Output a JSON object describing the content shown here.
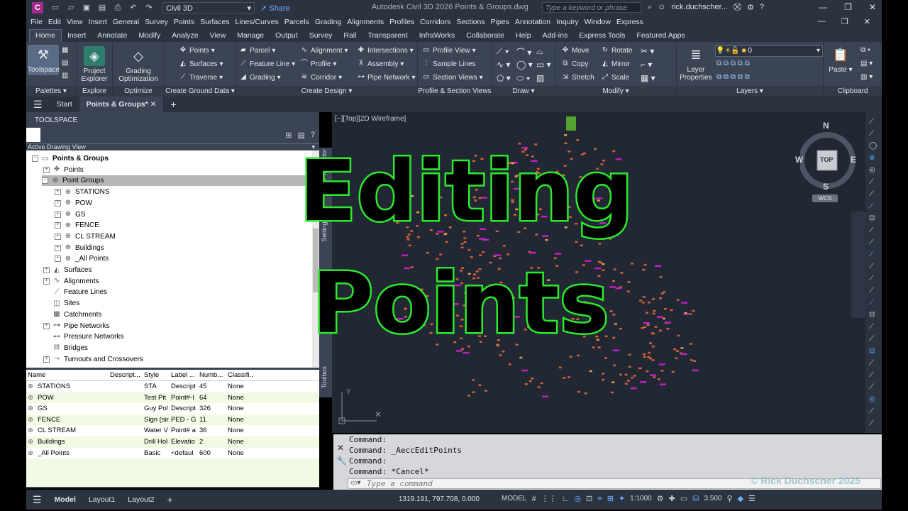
{
  "titlebar": {
    "app_icon": "C",
    "workspace": "Civil 3D",
    "share": "Share",
    "title": "Autodesk Civil 3D 2026   Points & Groups.dwg",
    "search_placeholder": "Type a keyword or phrase",
    "user": "rick.duchscher..."
  },
  "menubar": [
    "File",
    "Edit",
    "View",
    "Insert",
    "General",
    "Survey",
    "Points",
    "Surfaces",
    "Lines/Curves",
    "Parcels",
    "Grading",
    "Alignments",
    "Profiles",
    "Corridors",
    "Sections",
    "Pipes",
    "Annotation",
    "Inquiry",
    "Window",
    "Express"
  ],
  "ribbon_tabs": [
    "Home",
    "Insert",
    "Annotate",
    "Modify",
    "Analyze",
    "View",
    "Manage",
    "Output",
    "Survey",
    "Rail",
    "Transparent",
    "InfraWorks",
    "Collaborate",
    "Help",
    "Add-ins",
    "Express Tools",
    "Featured Apps"
  ],
  "ribbon": {
    "palettes": {
      "title": "Palettes",
      "toolspace": "Toolspace"
    },
    "explore": {
      "title": "Explore",
      "project_explorer": "Project Explorer"
    },
    "optimize": {
      "title": "Optimize",
      "grading_optimization": "Grading Optimization"
    },
    "ground": {
      "title": "Create Ground Data",
      "points": "Points",
      "surfaces": "Surfaces",
      "traverse": "Traverse"
    },
    "design": {
      "title": "Create Design",
      "parcel": "Parcel",
      "feature_line": "Feature Line",
      "grading": "Grading",
      "alignment": "Alignment",
      "profile": "Profile",
      "corridor": "Corridor",
      "intersections": "Intersections",
      "assembly": "Assembly",
      "pipe_network": "Pipe Network"
    },
    "profile_section": {
      "title": "Profile & Section Views",
      "profile_view": "Profile View",
      "sample_lines": "Sample Lines",
      "section_views": "Section Views"
    },
    "draw": {
      "title": "Draw"
    },
    "modify": {
      "title": "Modify",
      "move": "Move",
      "rotate": "Rotate",
      "copy": "Copy",
      "mirror": "Mirror",
      "stretch": "Stretch",
      "scale": "Scale"
    },
    "layers": {
      "title": "Layers",
      "layer_properties": "Layer Properties",
      "current_layer": "0"
    },
    "clipboard": {
      "title": "Clipboard",
      "paste": "Paste"
    }
  },
  "doc_tabs": {
    "start": "Start",
    "active": "Points & Groups*"
  },
  "toolspace": {
    "title": "TOOLSPACE",
    "view": "Active Drawing View",
    "tree": [
      {
        "label": "Points & Groups",
        "level": 0,
        "bold": true
      },
      {
        "label": "Points",
        "level": 1
      },
      {
        "label": "Point Groups",
        "level": 1,
        "selected": true
      },
      {
        "label": "STATIONS",
        "level": 2
      },
      {
        "label": "POW",
        "level": 2
      },
      {
        "label": "GS",
        "level": 2
      },
      {
        "label": "FENCE",
        "level": 2
      },
      {
        "label": "CL STREAM",
        "level": 2
      },
      {
        "label": "Buildings",
        "level": 2
      },
      {
        "label": "_All Points",
        "level": 2
      },
      {
        "label": "Surfaces",
        "level": 1
      },
      {
        "label": "Alignments",
        "level": 1
      },
      {
        "label": "Feature Lines",
        "level": 1
      },
      {
        "label": "Sites",
        "level": 1
      },
      {
        "label": "Catchments",
        "level": 1
      },
      {
        "label": "Pipe Networks",
        "level": 1
      },
      {
        "label": "Pressure Networks",
        "level": 1
      },
      {
        "label": "Bridges",
        "level": 1
      },
      {
        "label": "Turnouts and Crossovers",
        "level": 1
      }
    ],
    "side_tabs": {
      "prospector": "Prospector",
      "settings": "Settings",
      "toolbox": "Toolbox"
    },
    "grid_headers": [
      "Name",
      "Descript...",
      "Style",
      "Label ...",
      "Numb...",
      "Classifi..."
    ],
    "grid_rows": [
      [
        "STATIONS",
        "",
        "STA",
        "Descript",
        "45",
        "None"
      ],
      [
        "POW",
        "",
        "Test Pit",
        "Point#-I",
        "64",
        "None"
      ],
      [
        "GS",
        "",
        "Guy Pol",
        "Descript",
        "326",
        "None"
      ],
      [
        "FENCE",
        "",
        "Sign (sir",
        "PED - G",
        "11",
        "None"
      ],
      [
        "CL STREAM",
        "",
        "Water V",
        "Point# a",
        "36",
        "None"
      ],
      [
        "Buildings",
        "",
        "Drill Hol",
        "Elevatio",
        "2",
        "None"
      ],
      [
        "_All Points",
        "",
        "Basic",
        "<defaul",
        "600",
        "None"
      ]
    ]
  },
  "canvas": {
    "viewport": "[−][Top][2D Wireframe]",
    "compass": {
      "n": "N",
      "s": "S",
      "e": "E",
      "w": "W",
      "top": "TOP",
      "ucs": "WCS"
    }
  },
  "overlay": {
    "line1": "Editing",
    "line2": "Points"
  },
  "command": {
    "history": [
      "Command:",
      "Command: _AeccEditPoints",
      "Command:",
      "Command: *Cancel*"
    ],
    "placeholder": "Type a command"
  },
  "status": {
    "tabs": [
      "Model",
      "Layout1",
      "Layout2"
    ],
    "coords": "1319.191, 797.708, 0.000",
    "mode": "MODEL",
    "scale": "1:1000",
    "value": "3.500"
  },
  "copyright": "© Rick Duchscher 2025",
  "colors": {
    "accent": "#2bea2b",
    "bg_dark": "#212733",
    "panel": "#3b4453"
  }
}
